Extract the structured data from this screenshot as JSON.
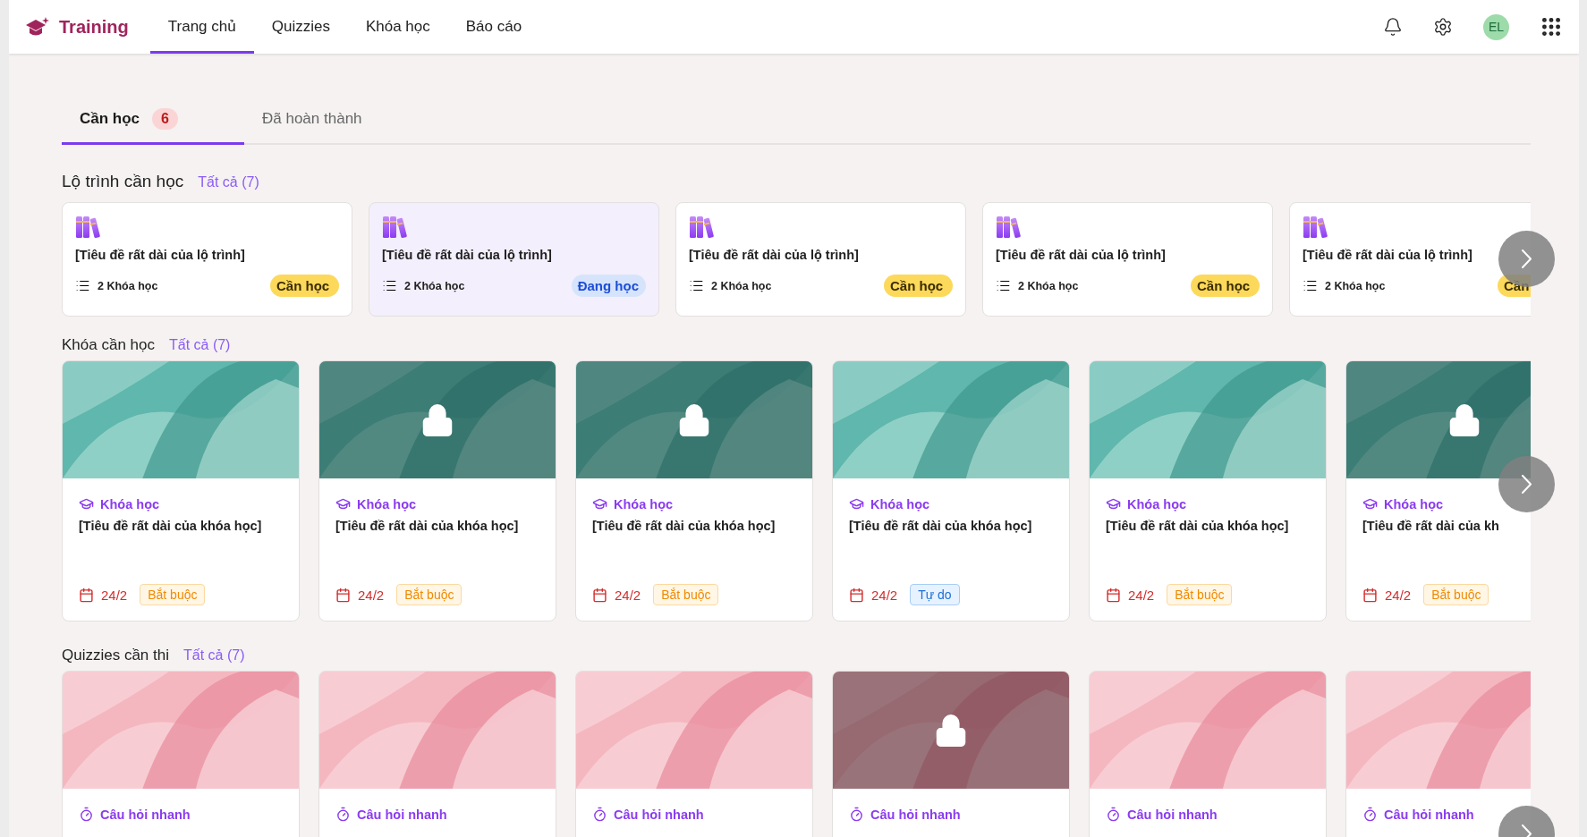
{
  "header": {
    "brand": "Training",
    "nav": [
      {
        "label": "Trang chủ",
        "selected": true
      },
      {
        "label": "Quizzies",
        "selected": false
      },
      {
        "label": "Khóa học",
        "selected": false
      },
      {
        "label": "Báo cáo",
        "selected": false
      }
    ],
    "avatar": "EL"
  },
  "tabs": [
    {
      "label": "Cần học",
      "badge": "6",
      "selected": true
    },
    {
      "label": "Đã hoàn thành",
      "selected": false
    }
  ],
  "paths": {
    "title": "Lộ trình cần học",
    "link": "Tất cả (7)",
    "items": [
      {
        "title": "[Tiêu đề rất dài của lộ trình]",
        "count": "2 Khóa học",
        "status": "Cần học",
        "kind": "todo",
        "selected": false
      },
      {
        "title": "[Tiêu đề rất dài của lộ trình]",
        "count": "2 Khóa học",
        "status": "Đang học",
        "kind": "doing",
        "selected": true
      },
      {
        "title": "[Tiêu đề rất dài của lộ trình]",
        "count": "2 Khóa học",
        "status": "Cần học",
        "kind": "todo",
        "selected": false
      },
      {
        "title": "[Tiêu đề rất dài của lộ trình]",
        "count": "2 Khóa học",
        "status": "Cần học",
        "kind": "todo",
        "selected": false
      },
      {
        "title": "[Tiêu đề rất dài của lộ trình]",
        "count": "2 Khóa học",
        "status": "Cần",
        "kind": "todo",
        "selected": false
      }
    ]
  },
  "courses": {
    "title": "Khóa cần học",
    "link": "Tất cả (7)",
    "items": [
      {
        "type": "Khóa học",
        "title": "[Tiêu đề rất dài của khóa học]",
        "date": "24/2",
        "tag": "Bắt buộc",
        "kind": "required",
        "locked": false
      },
      {
        "type": "Khóa học",
        "title": "[Tiêu đề rất dài của khóa học]",
        "date": "24/2",
        "tag": "Bắt buộc",
        "kind": "required",
        "locked": true
      },
      {
        "type": "Khóa học",
        "title": "[Tiêu đề rất dài của khóa học]",
        "date": "24/2",
        "tag": "Bắt buộc",
        "kind": "required",
        "locked": true
      },
      {
        "type": "Khóa học",
        "title": "[Tiêu đề rất dài của khóa học]",
        "date": "24/2",
        "tag": "Tự do",
        "kind": "free",
        "locked": false
      },
      {
        "type": "Khóa học",
        "title": "[Tiêu đề rất dài của khóa học]",
        "date": "24/2",
        "tag": "Bắt buộc",
        "kind": "required",
        "locked": false
      },
      {
        "type": "Khóa học",
        "title": "[Tiêu đề rất dài của kh",
        "date": "24/2",
        "tag": "Bắt buộc",
        "kind": "required",
        "locked": true
      }
    ]
  },
  "quizzes": {
    "title": "Quizzies cần thi",
    "link": "Tất cả (7)",
    "items": [
      {
        "type": "Câu hỏi nhanh",
        "locked": false
      },
      {
        "type": "Câu hỏi nhanh",
        "locked": false
      },
      {
        "type": "Câu hỏi nhanh",
        "locked": false
      },
      {
        "type": "Câu hỏi nhanh",
        "locked": true
      },
      {
        "type": "Câu hỏi nhanh",
        "locked": false
      },
      {
        "type": "Câu hỏi nhanh",
        "locked": false
      }
    ]
  }
}
